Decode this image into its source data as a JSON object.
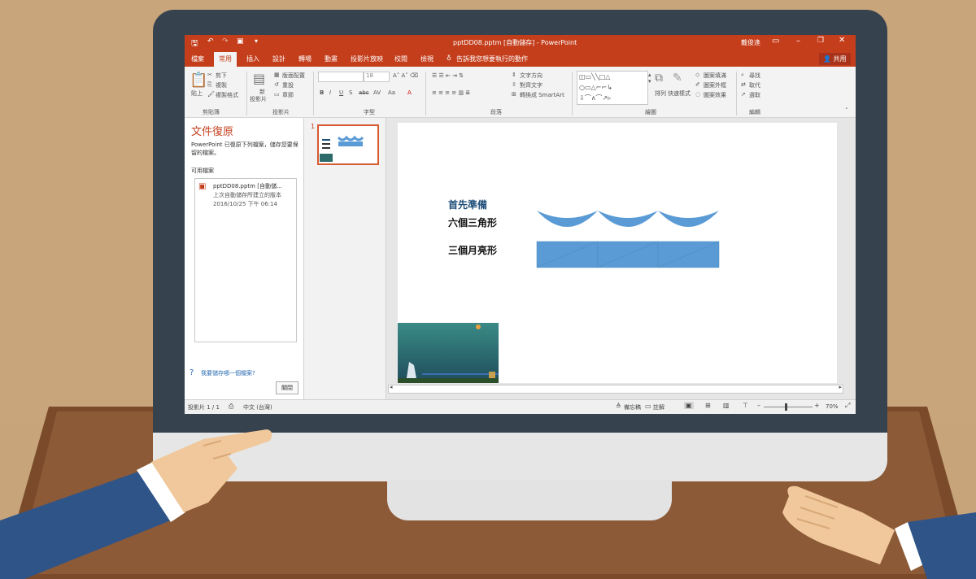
{
  "window": {
    "title": "pptDD08.pptm [自動儲存] - PowerPoint",
    "user": "戴俊逢",
    "share": "共用"
  },
  "ribbon_tabs": [
    "檔案",
    "常用",
    "插入",
    "設計",
    "轉場",
    "動畫",
    "投影片放映",
    "校閱",
    "檢視"
  ],
  "active_tab": "常用",
  "tell_me": "告訴我您想要執行的動作",
  "ribbon": {
    "clipboard": {
      "paste": "貼上",
      "cut": "剪下",
      "copy": "複製",
      "format_painter": "複製格式",
      "label": "剪貼簿"
    },
    "slides": {
      "new_slide": "新增投影片",
      "new_slide_l1": "新",
      "new_slide_l2": "投影片",
      "layout": "版面配置",
      "reset": "重設",
      "section": "章節",
      "label": "投影片"
    },
    "font": {
      "size": "18",
      "label": "字型"
    },
    "paragraph": {
      "text_direction": "文字方向",
      "align_text": "對齊文字",
      "smartart": "轉換成 SmartArt",
      "label": "段落"
    },
    "drawing": {
      "arrange": "排列",
      "quick_styles": "快速樣式",
      "shape_fill": "圖案填滿",
      "shape_outline": "圖案外框",
      "shape_effects": "圖案效果",
      "label": "繪圖"
    },
    "editing": {
      "find": "尋找",
      "replace": "取代",
      "select": "選取",
      "label": "編輯"
    }
  },
  "recovery": {
    "title": "文件復原",
    "description": "PowerPoint 已復原下列檔案，儲存您要保留的檔案。",
    "available_label": "可用檔案",
    "file_name": "pptDD08.pptm [自動儲...",
    "file_note": "上次自動儲存所建立的版本",
    "file_time": "2016/10/25 下午 06:14",
    "help_link": "我要儲存哪一個檔案?",
    "close": "關閉"
  },
  "thumbnail": {
    "number": "1"
  },
  "slide": {
    "heading": "首先準備",
    "line1": "六個三角形",
    "line2": "三個月亮形"
  },
  "status": {
    "slide_info": "投影片 1 / 1",
    "language": "中文 (台灣)",
    "notes": "備忘稿",
    "comments": "註解",
    "zoom": "70%"
  },
  "colors": {
    "accent": "#c43e1c",
    "shape_blue": "#5b9bd5",
    "heading_blue": "#1f4e79"
  }
}
